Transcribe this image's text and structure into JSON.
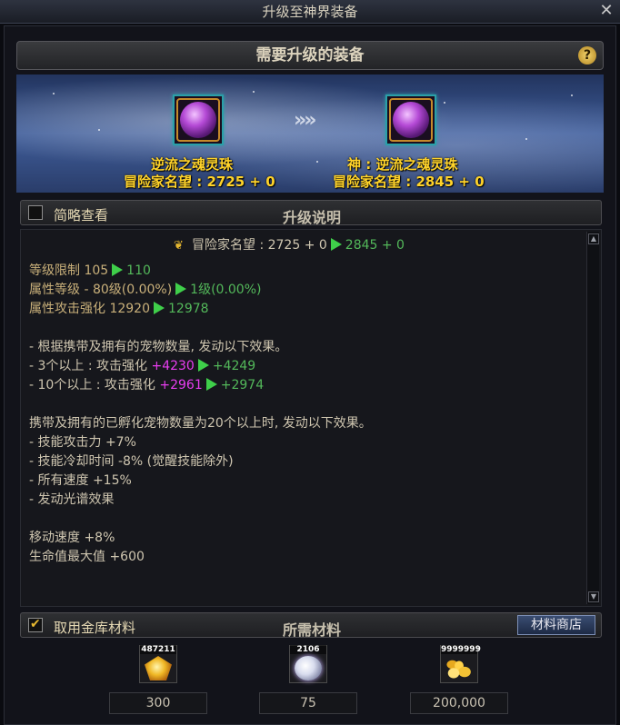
{
  "window": {
    "title": "升级至神界装备",
    "close_icon": "close-icon"
  },
  "header": {
    "title": "需要升级的装备",
    "help_label": "?"
  },
  "equipment": {
    "from": {
      "name": "逆流之魂灵珠",
      "fame": "冒险家名望 : 2725 + 0"
    },
    "to": {
      "name": "神 : 逆流之魂灵珠",
      "fame": "冒险家名望 : 2845 + 0"
    },
    "arrow_label": "»»"
  },
  "description_bar": {
    "checkbox_label": "简略查看",
    "title": "升级说明",
    "checked": false
  },
  "description": {
    "fame_line": {
      "label": "冒险家名望 : 2725 + 0",
      "to": "2845 + 0"
    },
    "stats": [
      {
        "label": "等级限制 105",
        "to": "110"
      },
      {
        "label": "属性等级 - 80级(0.00%)",
        "to": "1级(0.00%)"
      },
      {
        "label": "属性攻击强化 12920",
        "to": "12978"
      }
    ],
    "pet_intro": "- 根据携带及拥有的宠物数量, 发动以下效果。",
    "pet_tiers": [
      {
        "label": "- 3个以上 : 攻击强化",
        "from": "+4230",
        "to": "+4249"
      },
      {
        "label": "- 10个以上 : 攻击强化",
        "from": "+2961",
        "to": "+2974"
      }
    ],
    "hatch_intro": "携带及拥有的已孵化宠物数量为20个以上时, 发动以下效果。",
    "hatch_effects": [
      "- 技能攻击力 +7%",
      "- 技能冷却时间 -8% (觉醒技能除外)",
      "- 所有速度 +15%",
      "- 发动光谱效果"
    ],
    "extras": [
      "移动速度 +8%",
      "生命值最大值 +600"
    ]
  },
  "materials_bar": {
    "checkbox_label": "取用金库材料",
    "checked": true,
    "title": "所需材料",
    "shop_button": "材料商店"
  },
  "materials": [
    {
      "icon": "gold-gem-icon",
      "owned": "487211",
      "required": "300"
    },
    {
      "icon": "white-orb-icon",
      "owned": "2106",
      "required": "75"
    },
    {
      "icon": "gold-coins-icon",
      "owned": "9999999",
      "required": "200,000"
    }
  ]
}
